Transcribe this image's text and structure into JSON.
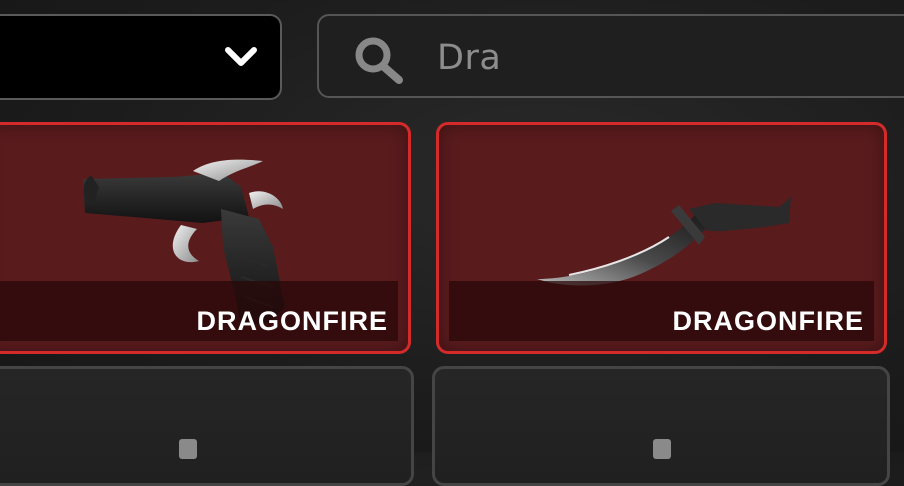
{
  "filter_dropdown": {
    "icon": "chevron-down-icon"
  },
  "search": {
    "value": "Dra",
    "icon": "search-icon"
  },
  "items": [
    {
      "name": "DRAGONFIRE",
      "kind": "revolver",
      "selected": true
    },
    {
      "name": "DRAGONFIRE",
      "kind": "knife",
      "selected": true
    }
  ],
  "colors": {
    "selected_border": "#d42a2a",
    "selected_bg": "#5a1b1d"
  }
}
